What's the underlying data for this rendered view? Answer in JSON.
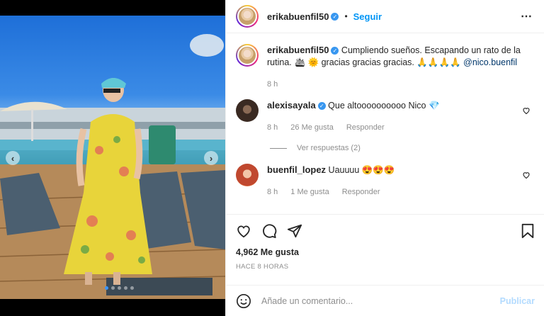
{
  "post": {
    "author": "erikabuenfil50",
    "separator": "•",
    "follow_label": "Seguir",
    "more_icon": "more-options-icon"
  },
  "caption": {
    "author": "erikabuenfil50",
    "text_before": "Cumpliendo sueños. Escapando un rato de la rutina. 🛳 🌞 gracias gracias gracias. 🙏🙏🙏🙏",
    "mention": "@nico.buenfil",
    "time": "8 h"
  },
  "comments": [
    {
      "author": "alexisayala",
      "verified": true,
      "text": "Que altoooooooooo Nico 💎",
      "time": "8 h",
      "likes": "26 Me gusta",
      "reply": "Responder"
    },
    {
      "author": "buenfil_lopez",
      "verified": false,
      "text": "Uauuuu 😍😍😍",
      "time": "8 h",
      "likes": "1 Me gusta",
      "reply": "Responder"
    }
  ],
  "view_replies": "Ver respuestas (2)",
  "likes_total": "4,962 Me gusta",
  "posted_ago": "HACE 8 HORAS",
  "add_comment": {
    "placeholder": "Añade un comentario...",
    "publish_label": "Publicar"
  },
  "carousel": {
    "prev": "‹",
    "next": "›",
    "count": 5,
    "active_index": 0
  },
  "colors": {
    "accent": "#0095f6",
    "verified": "#3897f0",
    "publish_disabled": "#b3dbff"
  }
}
